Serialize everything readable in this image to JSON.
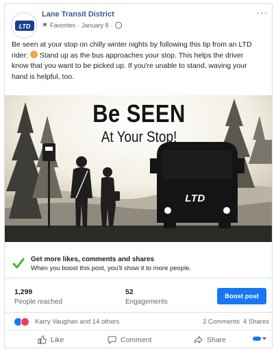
{
  "post": {
    "page_name": "Lane Transit District",
    "audience": "Favorites",
    "date": "January 8",
    "separator": "·",
    "more": "···",
    "text_line1": "Be seen at your stop on chilly winter nights by following this tip from an LTD",
    "text_line2": "rider:",
    "text_line2b": "Stand up as the bus approaches your stop. This helps the driver",
    "text_line3": "know that you want to be picked up. If you're unable to stand, waving your",
    "text_line4": "hand is helpful, too.",
    "logo_text": "LTD"
  },
  "graphic": {
    "title_line1": "Be SEEN",
    "title_line2": "At Your Stop!",
    "bus_logo": "LTD"
  },
  "boost_banner": {
    "title": "Get more likes, comments and shares",
    "subtitle": "When you boost this post, you'll show it to more people."
  },
  "stats": {
    "reached_value": "1,299",
    "reached_label": "People reached",
    "engagements_value": "52",
    "engagements_label": "Engagements",
    "boost_button": "Boost post"
  },
  "reactions": {
    "names": "Karry Vaughan and 14 others",
    "comments": "2 Comments",
    "shares": "4 Shares"
  },
  "actions": {
    "like": "Like",
    "comment": "Comment",
    "share": "Share"
  },
  "icons": {
    "reaction_like": "like-reaction-icon",
    "reaction_love": "love-reaction-icon",
    "audience": "star-icon",
    "privacy": "globe-icon"
  },
  "colors": {
    "brand_blue": "#1877f2",
    "page_link": "#385898",
    "check_green": "#42b72a",
    "love_red": "#f33e58"
  }
}
